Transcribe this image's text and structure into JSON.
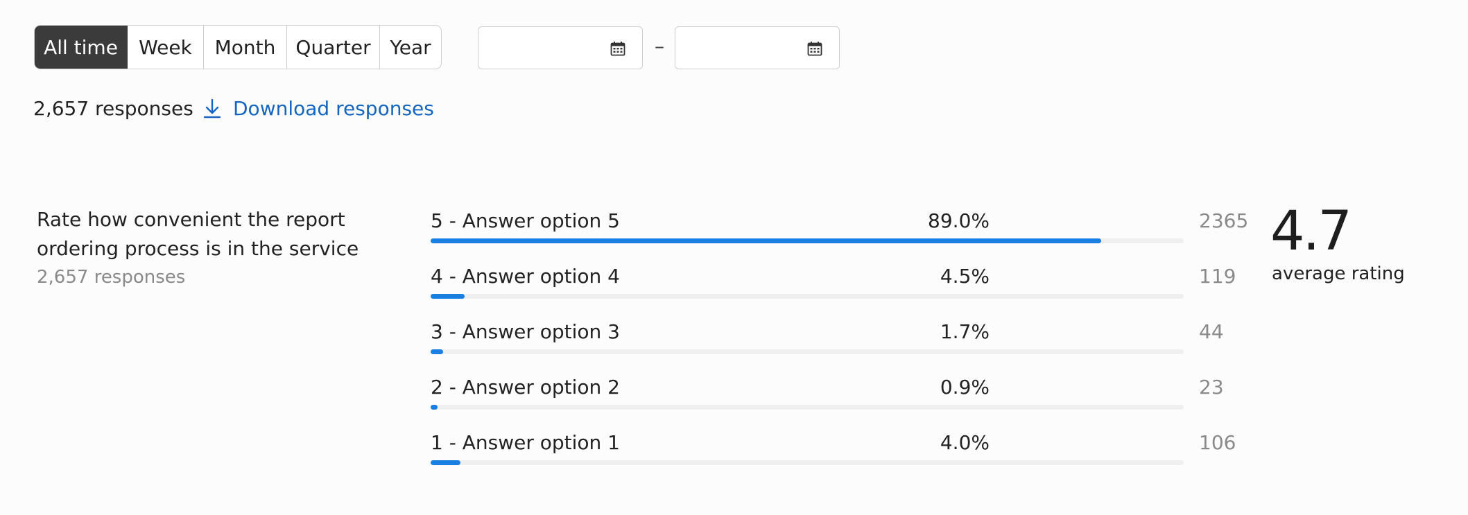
{
  "filters": {
    "periods": [
      {
        "label": "All time",
        "active": true
      },
      {
        "label": "Week",
        "active": false
      },
      {
        "label": "Month",
        "active": false
      },
      {
        "label": "Quarter",
        "active": false
      },
      {
        "label": "Year",
        "active": false
      }
    ],
    "date_from": {
      "value": "",
      "icon": "calendar-icon"
    },
    "date_separator": "–",
    "date_to": {
      "value": "",
      "icon": "calendar-icon"
    }
  },
  "summary": {
    "responses_label": "2,657 responses",
    "download_label": "Download responses",
    "download_icon": "download-icon",
    "link_color": "#1565c0"
  },
  "question": {
    "text": "Rate how convenient the report ordering process is in the service",
    "responses": "2,657 responses",
    "bar_color": "#1a7fe0",
    "answers": [
      {
        "label": "5 - Answer option 5",
        "percent_label": "89.0%",
        "percent": 89.0,
        "count": "2365"
      },
      {
        "label": "4 - Answer option 4",
        "percent_label": "4.5%",
        "percent": 4.5,
        "count": "119"
      },
      {
        "label": "3 - Answer option 3",
        "percent_label": "1.7%",
        "percent": 1.7,
        "count": "44"
      },
      {
        "label": "2 - Answer option 2",
        "percent_label": "0.9%",
        "percent": 0.9,
        "count": "23"
      },
      {
        "label": "1 - Answer option 1",
        "percent_label": "4.0%",
        "percent": 4.0,
        "count": "106"
      }
    ],
    "average_value": "4.7",
    "average_label": "average rating"
  }
}
